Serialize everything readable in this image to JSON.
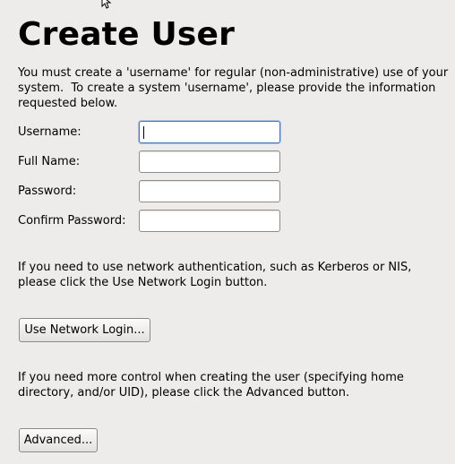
{
  "header": {
    "title": "Create User"
  },
  "intro": {
    "line1": "You must create a 'username' for regular (non-administrative) use of your",
    "line2": "system.  To create a system 'username', please provide the information",
    "line3": "requested below."
  },
  "form": {
    "username": {
      "label": "Username:",
      "value": ""
    },
    "full_name": {
      "label": "Full Name:",
      "value": ""
    },
    "password": {
      "label": "Password:",
      "value": ""
    },
    "confirm_password": {
      "label": "Confirm Password:",
      "value": ""
    }
  },
  "network": {
    "line1": "If you need to use network authentication, such as Kerberos or NIS,",
    "line2": "please click the Use Network Login button.",
    "button_label": "Use Network Login..."
  },
  "advanced": {
    "line1": "If you need more control when creating the user (specifying home",
    "line2": "directory, and/or UID), please click the Advanced button.",
    "button_label": "Advanced..."
  },
  "icons": {
    "cursor": "mouse-pointer-icon"
  }
}
